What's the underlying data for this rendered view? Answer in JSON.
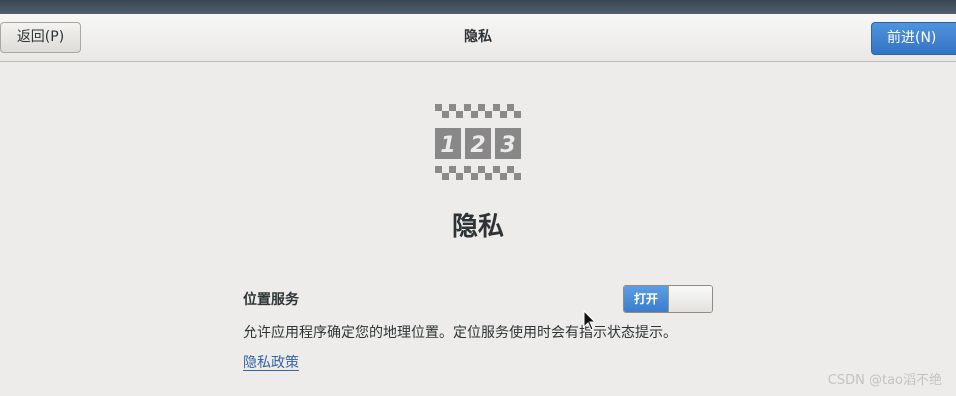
{
  "header": {
    "back_label": "返回(P)",
    "title": "隐私",
    "next_label": "前进(N)"
  },
  "main": {
    "icon": "privacy-123-icon",
    "title": "隐私",
    "location_service": {
      "label": "位置服务",
      "toggle_on_label": "打开",
      "description": "允许应用程序确定您的地理位置。定位服务使用时会有指示状态提示。"
    },
    "privacy_policy_link": "隐私政策"
  },
  "watermark": "CSDN @tao滔不绝",
  "colors": {
    "accent": "#3a7dcc",
    "link": "#3465a4",
    "background": "#edecea"
  }
}
